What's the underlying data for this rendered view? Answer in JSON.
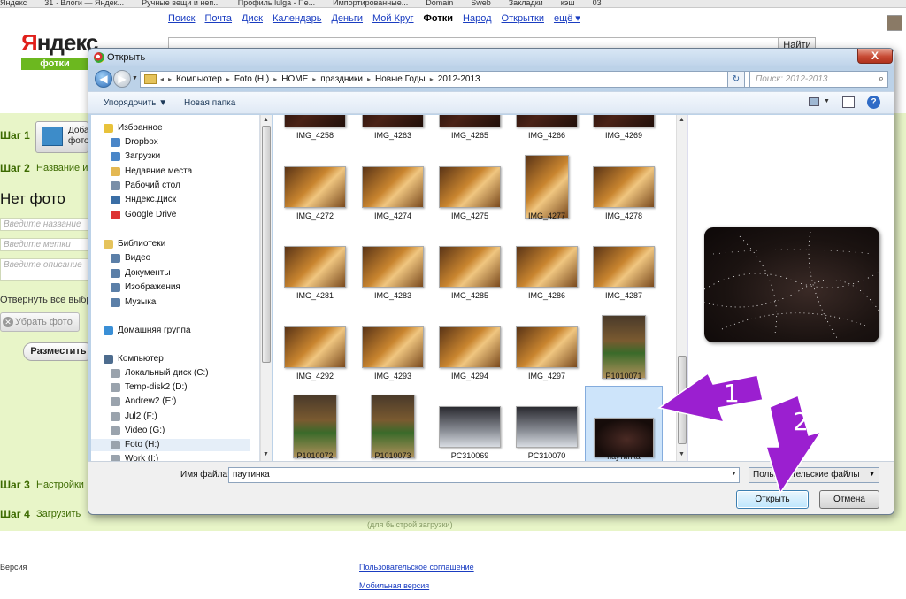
{
  "bookmarks": [
    "Яндекс",
    "31 · Влоги — Яндек...",
    "Ручные вещи и неп...",
    "Профиль lulga - Пе...",
    "Импортированные...",
    "Domain",
    "Sweb",
    "Закладки",
    "кэш",
    "03"
  ],
  "topnav": [
    {
      "label": "Поиск",
      "active": false
    },
    {
      "label": "Почта",
      "active": false
    },
    {
      "label": "Диск",
      "active": false
    },
    {
      "label": "Календарь",
      "active": false
    },
    {
      "label": "Деньги",
      "active": false
    },
    {
      "label": "Мой Круг",
      "active": false
    },
    {
      "label": "Фотки",
      "active": true
    },
    {
      "label": "Народ",
      "active": false
    },
    {
      "label": "Открытки",
      "active": false
    },
    {
      "label": "ещё ▾",
      "active": false
    }
  ],
  "logo": {
    "first": "Я",
    "rest": "ндекс",
    "sub": "фотки"
  },
  "search_button": "Найти",
  "steps": {
    "s1": "Шаг 1",
    "s2": "Шаг 2",
    "s2_link": "Название и",
    "s3": "Шаг 3",
    "s3_link": "Настройки",
    "s4": "Шаг 4",
    "s4_link": "Загрузить"
  },
  "upload_btn": "Доба... фото",
  "no_photo": "Нет фото",
  "ghost_inputs": [
    "Введите название",
    "Введите метки",
    "Введите описание"
  ],
  "select_all": "Отвернуть все выбранные",
  "remove_btn": "Убрать фото",
  "place_btn": "Разместить",
  "under_hint": "(для быстрой загрузки)",
  "footer": {
    "left": "Версия",
    "agreement": "Пользовательское соглашение",
    "mobile": "Мобильная версия"
  },
  "dialog": {
    "title": "Открыть",
    "close": "X",
    "breadcrumb": [
      "Компьютер",
      "Foto (H:)",
      "HOME",
      "праздники",
      "Новые Годы",
      "2012-2013"
    ],
    "search_placeholder": "Поиск: 2012-2013",
    "toolbar": {
      "organize": "Упорядочить ▼",
      "new_folder": "Новая папка"
    },
    "nav": {
      "favorites_header": "Избранное",
      "favorites": [
        "Dropbox",
        "Загрузки",
        "Недавние места",
        "Рабочий стол",
        "Яндекс.Диск",
        "Google Drive"
      ],
      "libraries_header": "Библиотеки",
      "libraries": [
        "Видео",
        "Документы",
        "Изображения",
        "Музыка"
      ],
      "homegroup": "Домашняя группа",
      "computer_header": "Компьютер",
      "drives": [
        "Локальный диск (C:)",
        "Temp-disk2 (D:)",
        "Andrew2 (E:)",
        "Jul2 (F:)",
        "Video (G:)",
        "Foto (H:)",
        "Work (I:)"
      ],
      "selected_drive": "Foto (H:)"
    },
    "rows": [
      [
        "IMG_4258",
        "IMG_4263",
        "IMG_4265",
        "IMG_4266",
        "IMG_4269"
      ],
      [
        "IMG_4272",
        "IMG_4274",
        "IMG_4275",
        "IMG_4277",
        "IMG_4278"
      ],
      [
        "IMG_4281",
        "IMG_4283",
        "IMG_4285",
        "IMG_4286",
        "IMG_4287"
      ],
      [
        "IMG_4292",
        "IMG_4293",
        "IMG_4294",
        "IMG_4297",
        "P1010071"
      ],
      [
        "P1010072",
        "P1010073",
        "PC310069",
        "PC310070",
        "паутинка"
      ]
    ],
    "selected_file": "паутинка",
    "filename_label": "Имя файла:",
    "filename_value": "паутинка",
    "filetype": "Пользовательские файлы",
    "open_btn": "Открыть",
    "cancel_btn": "Отмена"
  },
  "annotations": {
    "one": "1",
    "two": "2",
    "color": "#9b1fd0"
  }
}
